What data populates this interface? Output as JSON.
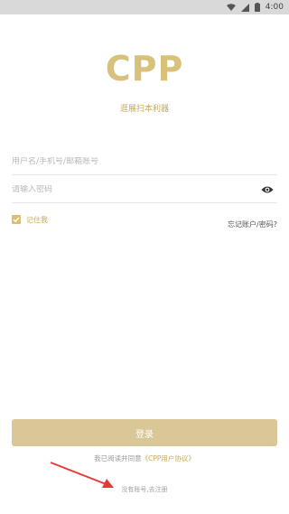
{
  "status_bar": {
    "time": "4:00",
    "icons": [
      "wifi-icon",
      "signal-icon",
      "battery-icon"
    ]
  },
  "logo": {
    "text": "CPP",
    "slogan": "逛展扫本利器"
  },
  "form": {
    "username_placeholder": "用户名/手机号/邮箱账号",
    "password_placeholder": "请输入密码",
    "remember_label": "记住我",
    "remember_checked": true,
    "forgot_label": "忘记账户/密码?"
  },
  "actions": {
    "login_label": "登录",
    "agree_prefix": "我已阅读并同意",
    "agree_link": "《CPP用户协议》",
    "register_label": "没有账号,去注册"
  },
  "colors": {
    "brand_gold": "#d8c27b",
    "button_bg": "#d9c797",
    "annotation_arrow": "#e53935"
  }
}
